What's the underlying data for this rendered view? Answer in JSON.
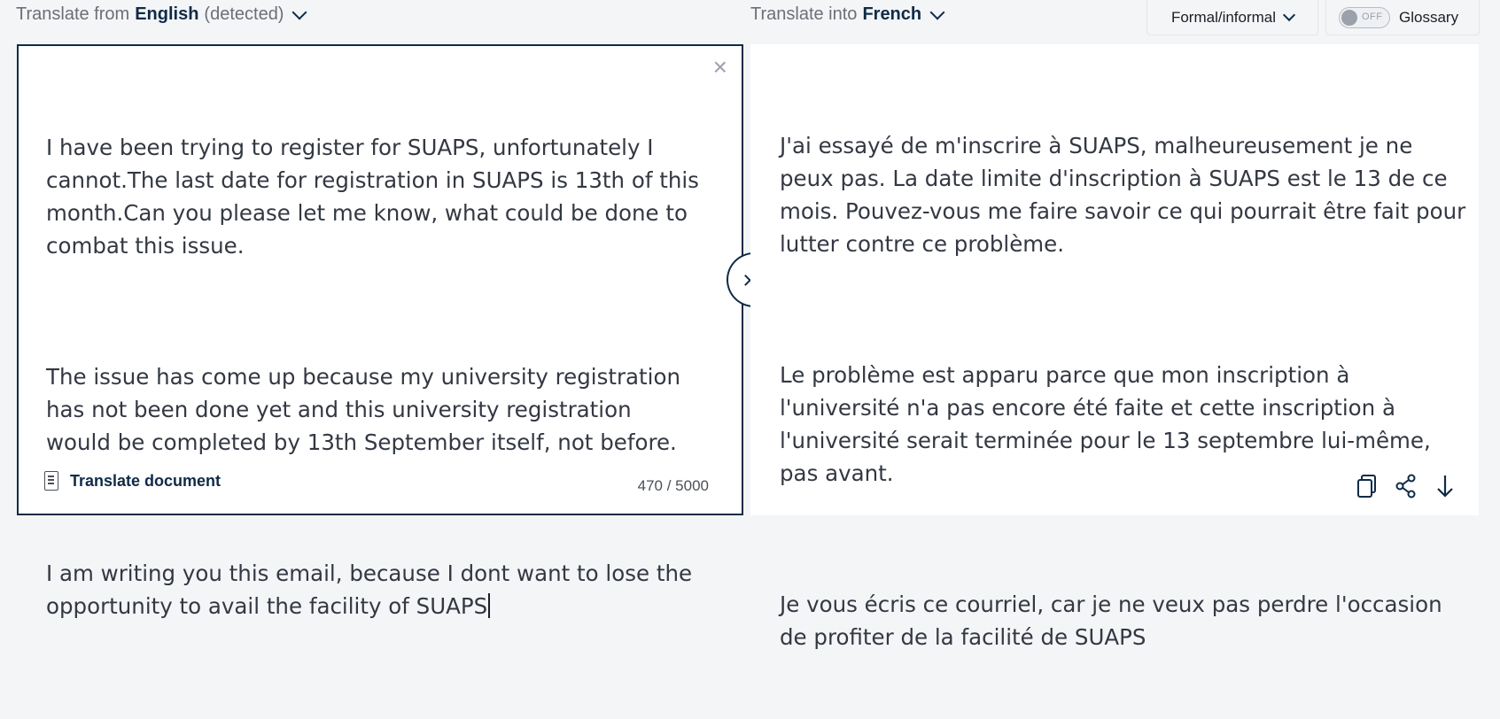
{
  "source": {
    "prefix": "Translate from",
    "language": "English",
    "detected": "(detected)",
    "text_paragraphs": [
      "I have been trying to register for SUAPS, unfortunately I cannot.The last date for registration in SUAPS is 13th of this month.Can you please let me know, what could be done to combat this issue.",
      "The issue has come up because my university registration has not been done yet and this university registration would be completed by 13th September itself, not before.",
      "I am writing you this email, because I dont want to lose the opportunity to avail the facility of SUAPS"
    ],
    "clear_icon": "×",
    "translate_document_label": "Translate document",
    "char_count": "470 / 5000"
  },
  "target": {
    "prefix": "Translate into",
    "language": "French",
    "text_paragraphs": [
      "J'ai essayé de m'inscrire à SUAPS, malheureusement je ne peux pas. La date limite d'inscription à SUAPS est le 13 de ce mois. Pouvez-vous me faire savoir ce qui pourrait être fait pour lutter contre ce problème.",
      "Le problème est apparu parce que mon inscription à l'université n'a pas encore été faite et cette inscription à l'université serait terminée pour le 13 septembre lui-même, pas avant.",
      "Je vous écris ce courriel, car je ne veux pas perdre l'occasion de profiter de la facilité de SUAPS"
    ]
  },
  "toolbar": {
    "formality_label": "Formal/informal",
    "glossary_toggle_state": "OFF",
    "glossary_label": "Glossary"
  },
  "icons": {
    "swap": "chevron-right-icon",
    "copy": "copy-icon",
    "share": "share-icon",
    "download": "download-icon",
    "document": "document-icon"
  },
  "colors": {
    "accent": "#0f2b46",
    "text": "#333842",
    "muted": "#6b6f76",
    "background": "#f4f5f7"
  }
}
